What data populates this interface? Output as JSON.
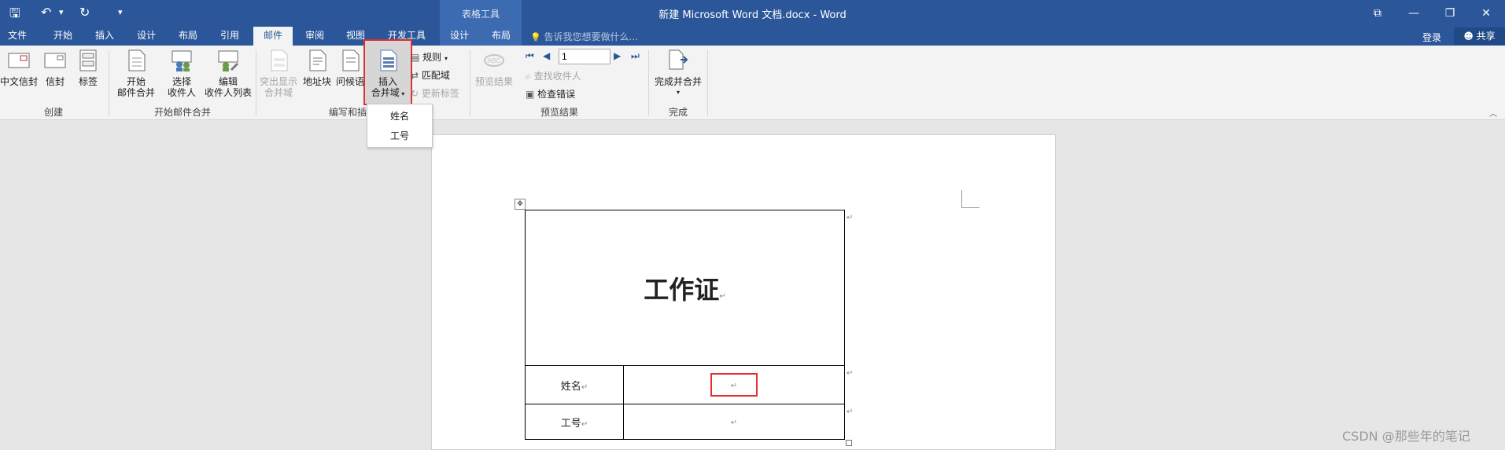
{
  "window": {
    "title": "新建 Microsoft Word 文档.docx - Word",
    "contextual_group": "表格工具",
    "restore_symbol": "⧉",
    "minimize_symbol": "—",
    "maximize_symbol": "❐",
    "close_symbol": "✕"
  },
  "qat": {
    "save": "🖫",
    "undo": "↶",
    "undo_dropdown": "▾",
    "redo": "↻",
    "customize": "▾"
  },
  "tabs": [
    {
      "label": "文件"
    },
    {
      "label": "开始"
    },
    {
      "label": "插入"
    },
    {
      "label": "设计"
    },
    {
      "label": "布局"
    },
    {
      "label": "引用"
    },
    {
      "label": "邮件",
      "active": true
    },
    {
      "label": "审阅"
    },
    {
      "label": "视图"
    },
    {
      "label": "开发工具"
    },
    {
      "label": "设计"
    },
    {
      "label": "布局"
    }
  ],
  "tell_me": {
    "icon": "💡",
    "placeholder": "告诉我您想要做什么..."
  },
  "account": {
    "login": "登录",
    "share": "共享"
  },
  "ribbon": {
    "create": {
      "group": "创建",
      "chinese_envelope": "中文信封",
      "envelope": "信封",
      "label": "标签"
    },
    "start_merge": {
      "group": "开始邮件合并",
      "start_l1": "开始",
      "start_l2": "邮件合并",
      "select_l1": "选择",
      "select_l2": "收件人",
      "edit_l1": "编辑",
      "edit_l2": "收件人列表"
    },
    "write_insert": {
      "group": "编写和插",
      "highlight_l1": "突出显示",
      "highlight_l2": "合并域",
      "address_block": "地址块",
      "greeting": "问候语",
      "insert_l1": "插入",
      "insert_l2": "合并域",
      "rules": "规则",
      "match_fields": "匹配域",
      "update_labels": "更新标签"
    },
    "preview": {
      "group": "预览结果",
      "preview_results": "预览结果",
      "record": "1",
      "find_recipient": "查找收件人",
      "check_errors": "检查错误"
    },
    "finish": {
      "group": "完成",
      "finish_merge": "完成并合并"
    }
  },
  "dropdown": {
    "items": [
      "姓名",
      "工号"
    ]
  },
  "document": {
    "card_title": "工作证",
    "row1_label": "姓名",
    "row2_label": "工号",
    "para_mark": "↵"
  },
  "watermark": "CSDN @那些年的笔记",
  "colors": {
    "title_bar": "#2b579a",
    "highlight_box": "#e03030"
  }
}
